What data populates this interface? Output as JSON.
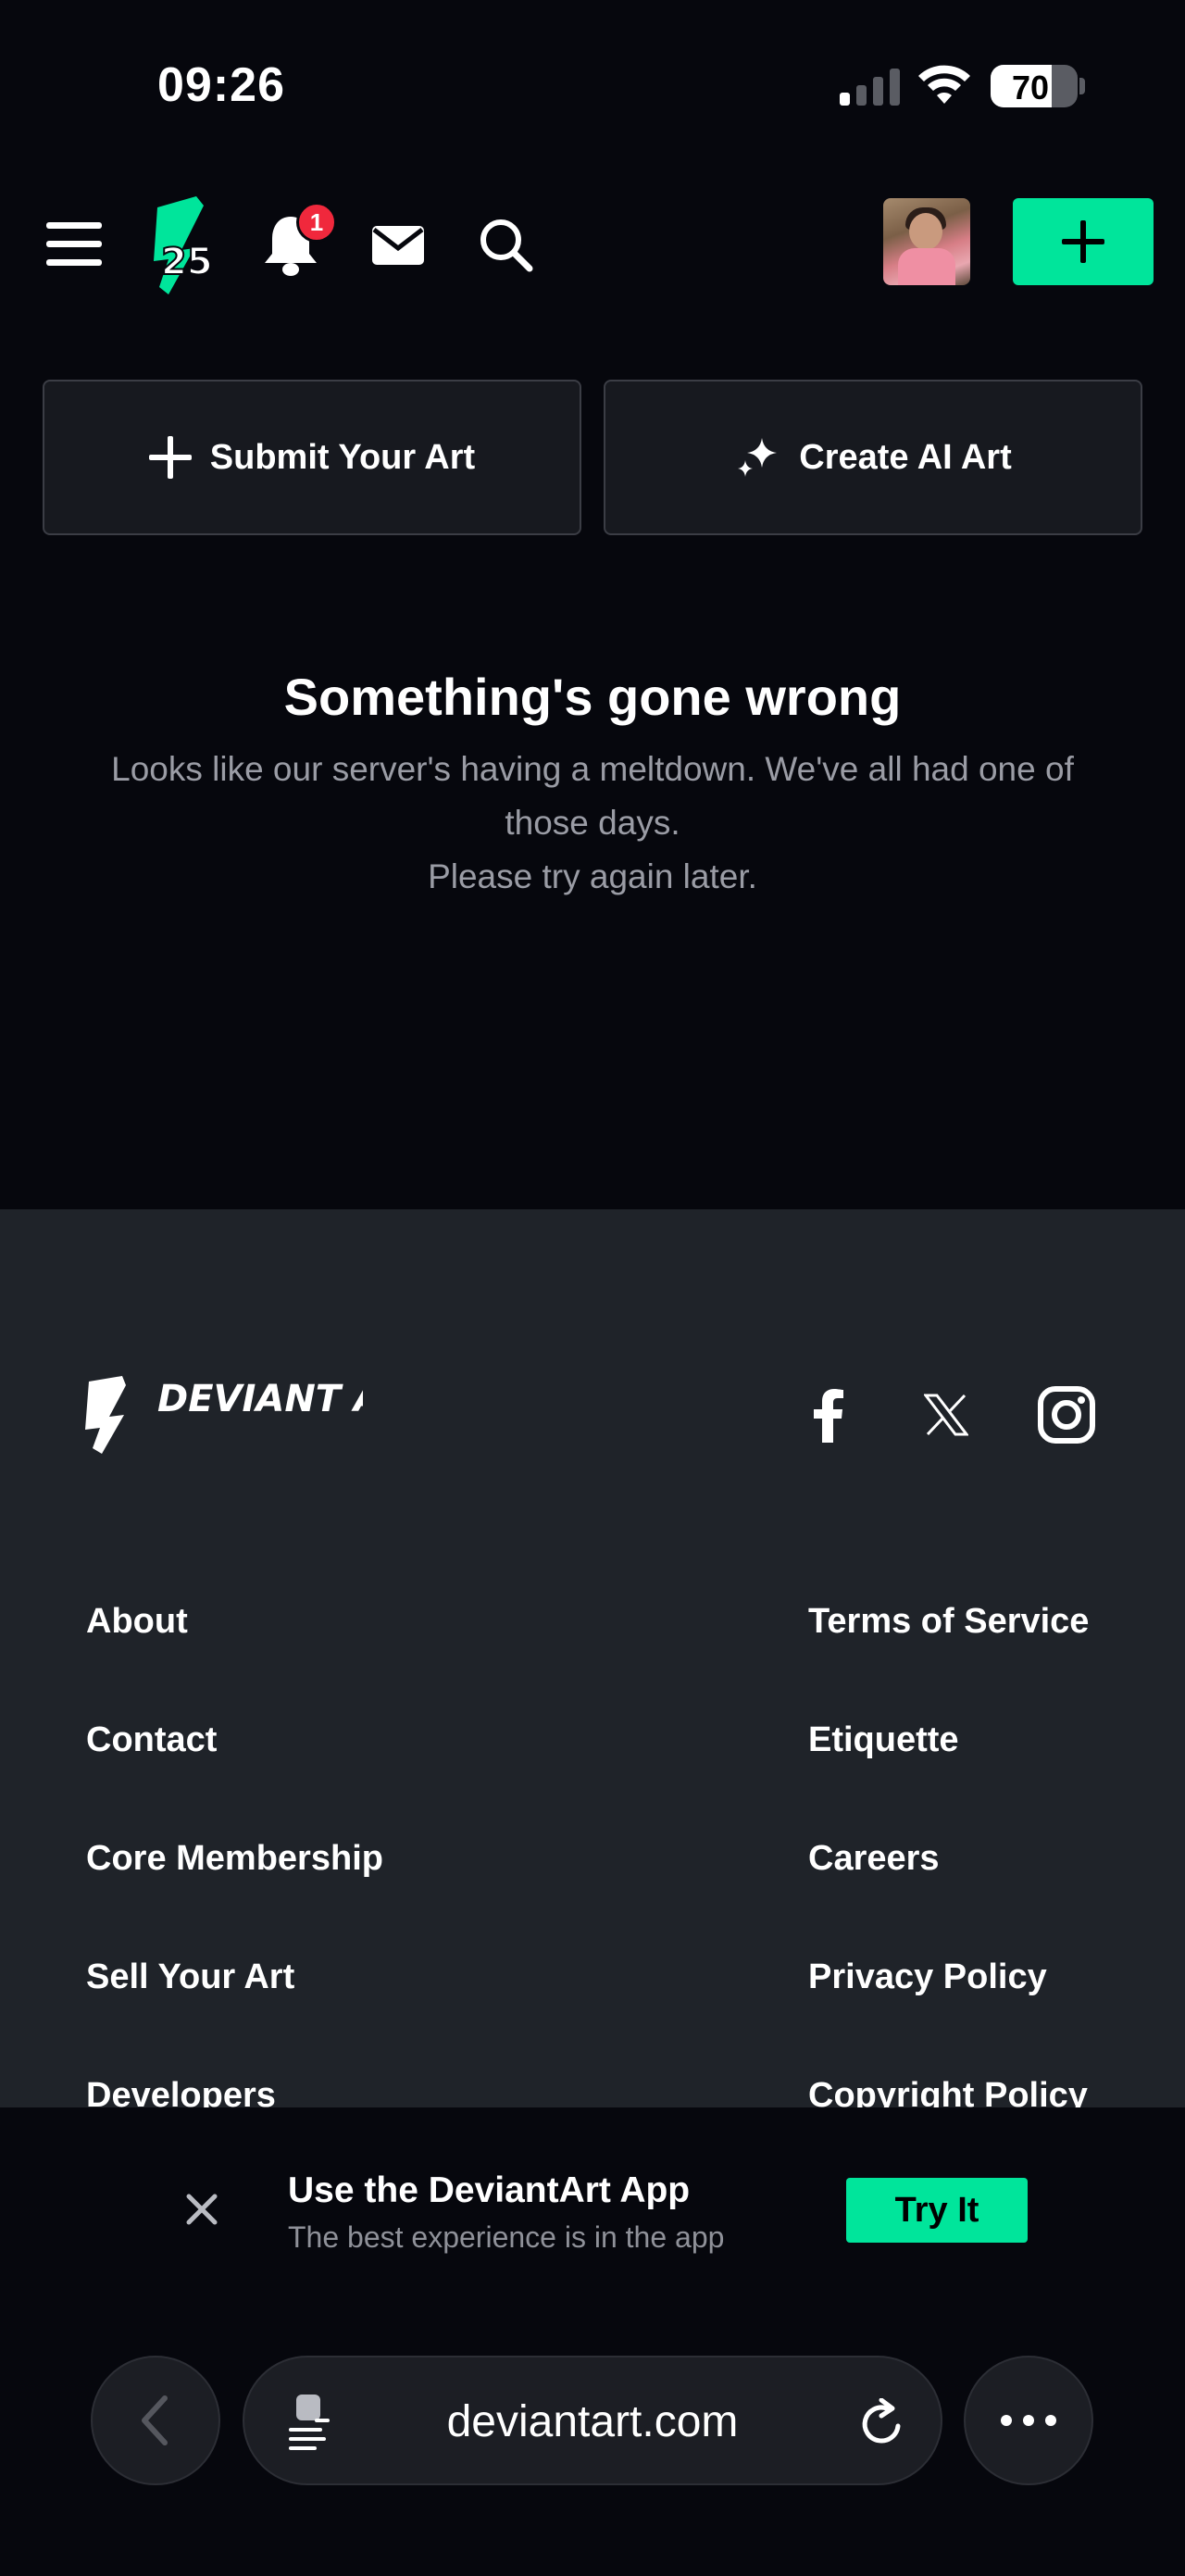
{
  "status_bar": {
    "time": "09:26",
    "battery": "70",
    "battery_level": 0.7
  },
  "nav": {
    "notification_count": "1",
    "icons": [
      "menu-icon",
      "deviantart-25-logo",
      "bell-icon",
      "mail-icon",
      "search-icon",
      "plus-icon"
    ],
    "accent_color": "#00e59b"
  },
  "actions": {
    "submit_label": "Submit Your Art",
    "ai_label": "Create AI Art"
  },
  "error": {
    "title": "Something's gone wrong",
    "line1": "Looks like our server's having a meltdown. We've all had one of",
    "line2": "those days.",
    "line3": "Please try again later."
  },
  "footer": {
    "logo_text": "DEVIANT ART",
    "social": [
      "facebook-icon",
      "x-icon",
      "instagram-icon"
    ],
    "left_links": [
      "About",
      "Contact",
      "Core Membership",
      "Sell Your Art",
      "Developers"
    ],
    "right_links": [
      "Terms of Service",
      "Etiquette",
      "Careers",
      "Privacy Policy",
      "Copyright Policy"
    ]
  },
  "app_banner": {
    "title": "Use the DeviantArt App",
    "subtitle": "The best experience is in the app",
    "button": "Try It"
  },
  "browser": {
    "url": "deviantart.com"
  }
}
